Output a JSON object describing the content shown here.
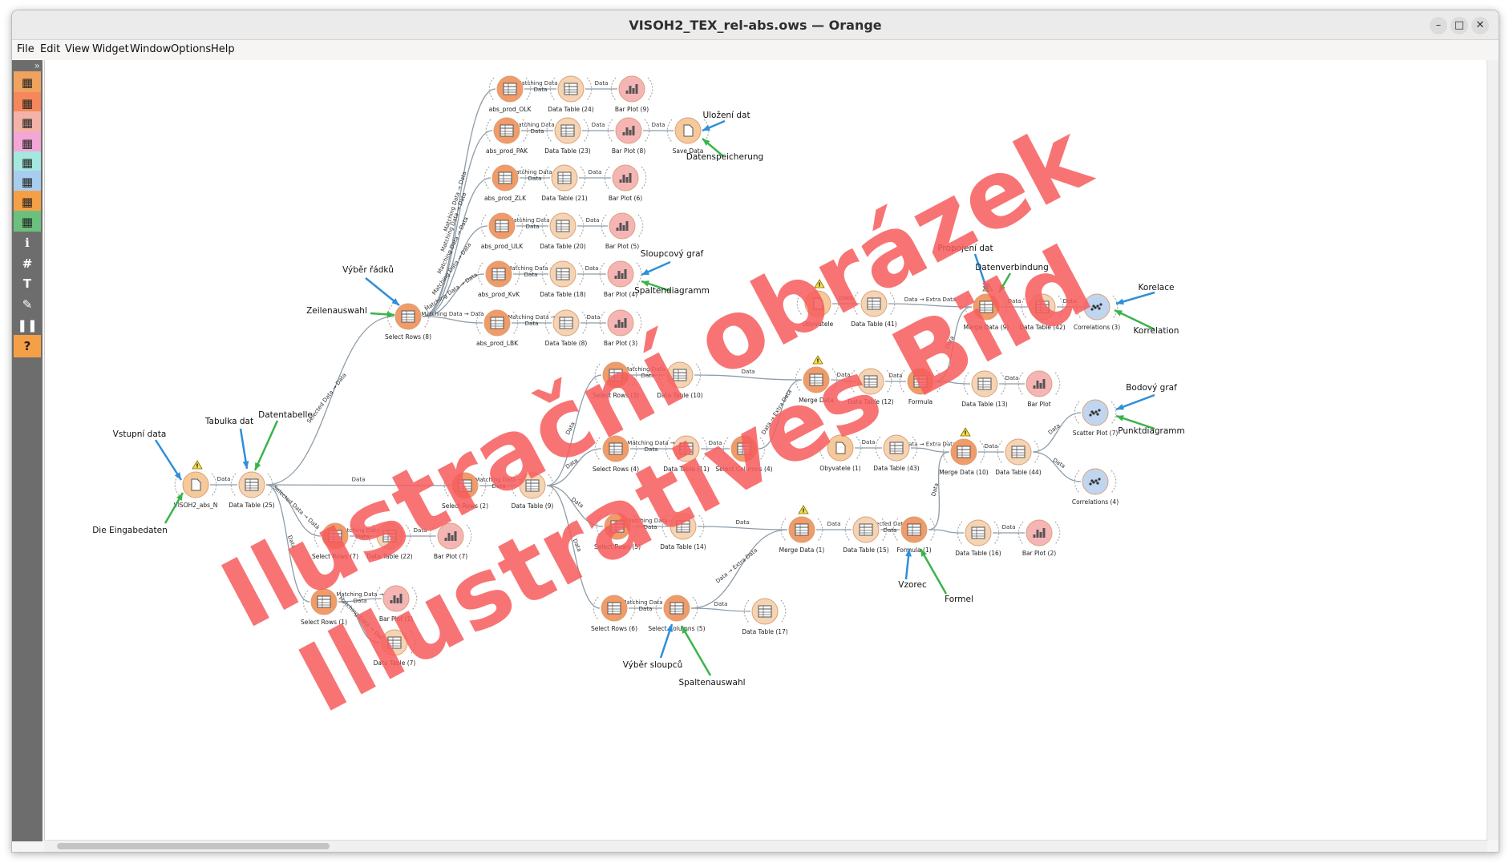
{
  "window": {
    "title": "VISOH2_TEX_rel-abs.ows — Orange",
    "minimize": "–",
    "maximize": "□",
    "close": "✕"
  },
  "menu": [
    "File",
    "Edit",
    "View",
    "Widget",
    "Window",
    "Options",
    "Help"
  ],
  "toolbox": {
    "collapse": "»",
    "items": [
      {
        "icon": "data-category-icon",
        "color": "#f0a35e"
      },
      {
        "icon": "transform-category-icon",
        "color": "#f5875a"
      },
      {
        "icon": "visualize-category-icon",
        "color": "#f4b3a8"
      },
      {
        "icon": "model-category-icon",
        "color": "#f4a6d7"
      },
      {
        "icon": "evaluate-category-icon",
        "color": "#a4e8df"
      },
      {
        "icon": "unsupervised-category-icon",
        "color": "#a9cdee"
      },
      {
        "icon": "educational-category-icon",
        "color": "#f5a047"
      },
      {
        "icon": "geo-category-icon",
        "color": "#6cc07d"
      },
      {
        "icon": "info-icon",
        "color": "#6d6d6d"
      },
      {
        "icon": "hash-icon",
        "color": "#6d6d6d"
      },
      {
        "icon": "text-icon",
        "color": "#6d6d6d"
      },
      {
        "icon": "pen-icon",
        "color": "#6d6d6d"
      },
      {
        "icon": "pause-icon",
        "color": "#6d6d6d"
      },
      {
        "icon": "help-icon",
        "color": "#f5a047"
      }
    ]
  },
  "colors": {
    "file": "#f6c99a",
    "transform": "#f09b68",
    "table": "#f5d4b4",
    "plot": "#f6b5b5",
    "unsup": "#c0d6f0",
    "edge": "#8c9ca8",
    "warn": "#f8e04a"
  },
  "nodes": {
    "n0": "VISOH2_abs_N",
    "n1": "Data Table (25)",
    "n2": "Select Rows (8)",
    "n3": "abs_prod_OLK",
    "n4": "Data Table (24)",
    "n5": "Bar Plot (9)",
    "n6": "abs_prod_PAK",
    "n7": "Data Table (23)",
    "n8": "Bar Plot (8)",
    "n9": "Save Data",
    "n10": "abs_prod_ZLK",
    "n11": "Data Table (21)",
    "n12": "Bar Plot (6)",
    "n13": "abs_prod_ULK",
    "n14": "Data Table (20)",
    "n15": "Bar Plot (5)",
    "n16": "abs_prod_KvK",
    "n17": "Data Table (18)",
    "n18": "Bar Plot (4)",
    "n19": "abs_prod_LBK",
    "n20": "Data Table (8)",
    "n21": "Bar Plot (3)",
    "n22": "Select Rows (3)",
    "n23": "Data Table (10)",
    "n24": "Merge Data",
    "n25": "Data Table (12)",
    "n26": "Formula",
    "n27": "Data Table (13)",
    "n28": "Bar Plot",
    "n29": "Select Rows (2)",
    "n30": "Data Table (9)",
    "n31": "Select Rows (4)",
    "n32": "Data Table (11)",
    "n33": "Select Columns (4)",
    "n34": "Select Rows (5)",
    "n35": "Data Table (14)",
    "n36": "Merge Data (1)",
    "n37": "Data Table (15)",
    "n38": "Formula (1)",
    "n39": "Data Table (16)",
    "n40": "Bar Plot (2)",
    "n41": "Select Rows (7)",
    "n42": "Data Table (22)",
    "n43": "Bar Plot (7)",
    "n44": "Select Rows (1)",
    "n45": "Bar Plot (1)",
    "n46": "Data Table (7)",
    "n47": "Select Rows (6)",
    "n48": "Select Columns (5)",
    "n49": "Data Table (17)",
    "n50": "Obyvatele",
    "n51": "Data Table (41)",
    "n52": "Merge Data (9)",
    "n53": "Data Table (42)",
    "n54": "Correlations (3)",
    "n55": "Obyvatele (1)",
    "n56": "Data Table (43)",
    "n57": "Merge Data (10)",
    "n58": "Data Table (44)",
    "n59": "Scatter Plot (7)",
    "n60": "Correlations (4)"
  },
  "links": {
    "data": "Data",
    "matching": "Matching Data →",
    "matching2": "Data",
    "extra": "Data → Extra Data",
    "selected": "Selected Data → Data",
    "selected1": "Selected Data →",
    "matchingData": "Matching Data → Data"
  },
  "annotations": {
    "vstupni": "Vstupní data",
    "eingabe": "Die Eingabedaten",
    "tabulka": "Tabulka dat",
    "datentabelle": "Datentabelle",
    "vyber_radku": "Výběr řádků",
    "zeilen": "Zeilenauswahl",
    "ulozeni": "Uložení dat",
    "speicherung": "Datenspeicherung",
    "sloupcovy": "Sloupcový graf",
    "spalten_diag": "Spaltendiagramm",
    "propojeni": "Propojení dat",
    "verbindung": "Datenverbindung",
    "korelace": "Korelace",
    "korrelation": "Korrelation",
    "bodovy": "Bodový graf",
    "punkt": "Punktdiagramm",
    "vzorec": "Vzorec",
    "formel": "Formel",
    "vyber_sloupcu": "Výběr sloupců",
    "spaltenaus": "Spaltenauswahl"
  },
  "watermark": {
    "line1": "Ilustrační obrázek",
    "line2": "Illustratives Bild"
  }
}
